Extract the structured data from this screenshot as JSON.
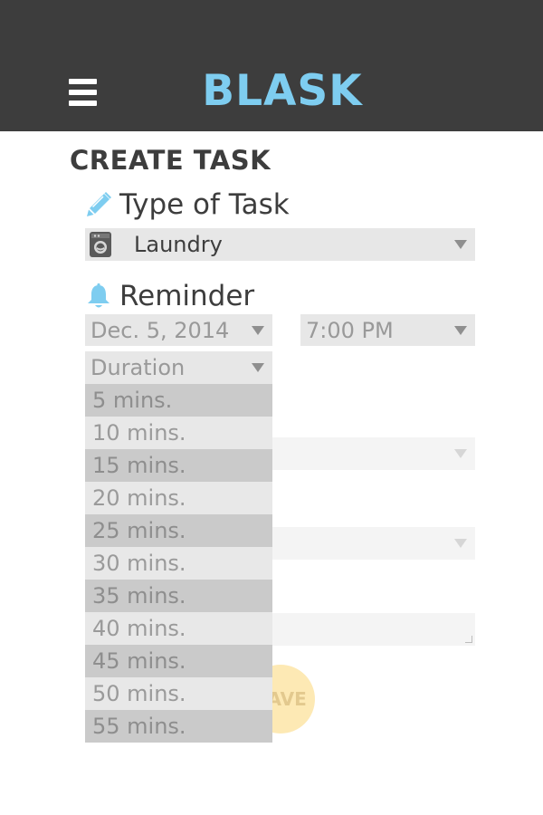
{
  "app": {
    "title": "BLASK"
  },
  "page": {
    "title": "CREATE TASK"
  },
  "task_type": {
    "heading": "Type of Task",
    "selected": "Laundry"
  },
  "reminder": {
    "heading": "Reminder",
    "date": "Dec. 5, 2014",
    "time": "7:00 PM"
  },
  "duration": {
    "placeholder": "Duration",
    "options": [
      "5 mins.",
      "10 mins.",
      "15 mins.",
      "20 mins.",
      "25 mins.",
      "30 mins.",
      "35 mins.",
      "40 mins.",
      "45 mins.",
      "50 mins.",
      "55 mins."
    ]
  },
  "save_button": {
    "label": "SAVE"
  },
  "colors": {
    "header_bg": "#3d3d3d",
    "brand_blue": "#7ecdf0",
    "save_yellow": "#fde9b4"
  },
  "icons": {
    "menu": "menu-icon",
    "pencil": "pencil-icon",
    "washing_machine": "washing-machine-icon",
    "bell": "bell-icon"
  }
}
